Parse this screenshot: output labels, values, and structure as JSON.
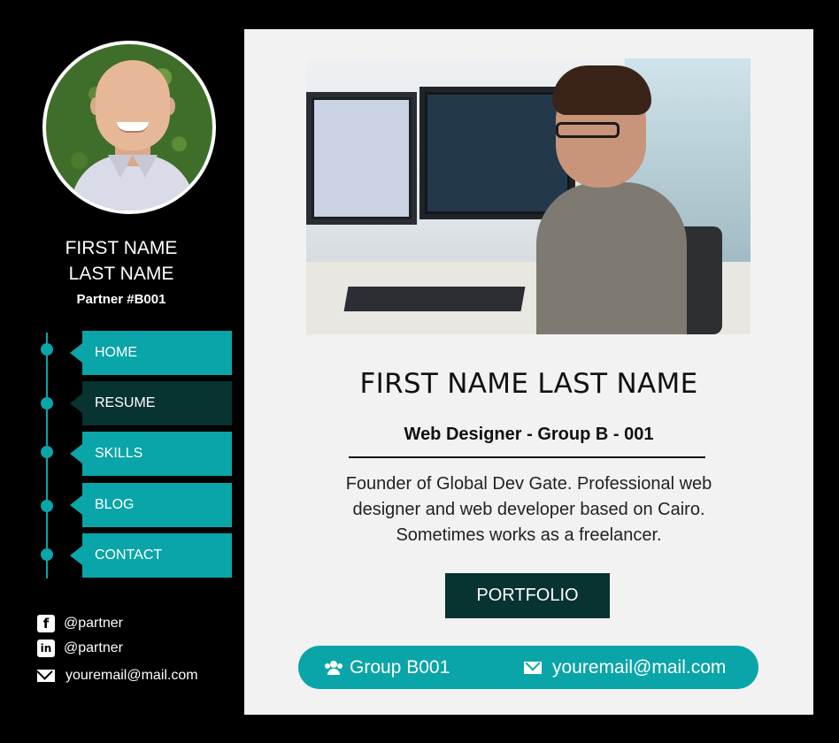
{
  "sidebar": {
    "name_first": "FIRST NAME",
    "name_last": "LAST NAME",
    "partner": "Partner #B001",
    "nav": [
      {
        "label": "HOME"
      },
      {
        "label": "RESUME"
      },
      {
        "label": "SKILLS"
      },
      {
        "label": "BLOG"
      },
      {
        "label": "CONTACT"
      }
    ],
    "active_nav": "RESUME",
    "social": [
      {
        "icon": "facebook-icon",
        "text": "@partner"
      },
      {
        "icon": "linkedin-icon",
        "text": "@partner"
      },
      {
        "icon": "mail-icon",
        "text": "youremail@mail.com"
      }
    ]
  },
  "main": {
    "title": "FIRST NAME LAST NAME",
    "subtitle": "Web Designer - Group B - 001",
    "bio": "Founder of Global Dev Gate. Professional web designer and web developer based on Cairo. Sometimes works as a freelancer.",
    "portfolio_label": "PORTFOLIO",
    "info": {
      "group_icon": "users-icon",
      "group_text": "Group B001",
      "email_icon": "envelope-icon",
      "email_text": "youremail@mail.com"
    }
  },
  "colors": {
    "accent": "#0aa5a8",
    "dark_accent": "#073330",
    "panel_bg": "#f2f2f2",
    "page_bg": "#000000"
  }
}
